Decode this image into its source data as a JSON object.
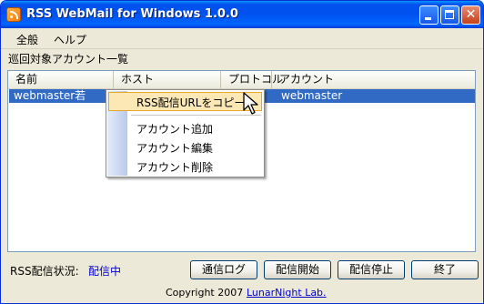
{
  "window": {
    "title": "RSS WebMail for Windows 1.0.0",
    "close_glyph": "✕"
  },
  "menubar": {
    "items": [
      "全般",
      "ヘルプ"
    ]
  },
  "section_label": "巡回対象アカウント一覧",
  "table": {
    "columns": [
      "名前",
      "ホスト",
      "プロトコル",
      "アカウント"
    ],
    "rows": [
      {
        "name": "webmaster若",
        "host": "",
        "protocol": "",
        "account": "webmaster",
        "selected": true
      }
    ]
  },
  "context_menu": {
    "items": [
      "RSS配信URLをコピー",
      "アカウント追加",
      "アカウント編集",
      "アカウント削除"
    ],
    "highlighted_index": 0
  },
  "status": {
    "label": "RSS配信状況:",
    "value": "配信中"
  },
  "buttons": {
    "log": "通信ログ",
    "start": "配信開始",
    "stop": "配信停止",
    "exit": "終了"
  },
  "footer": {
    "copyright": "Copyright 2007",
    "link": "LunarNight Lab."
  },
  "colors": {
    "title_bar": "#0054e3",
    "selection": "#316ac5",
    "status_value": "#0000c8",
    "menu_highlight": "#fbe8b4"
  },
  "icons": {
    "app": "rss-feed-icon",
    "cursor": "arrow-cursor-icon"
  }
}
